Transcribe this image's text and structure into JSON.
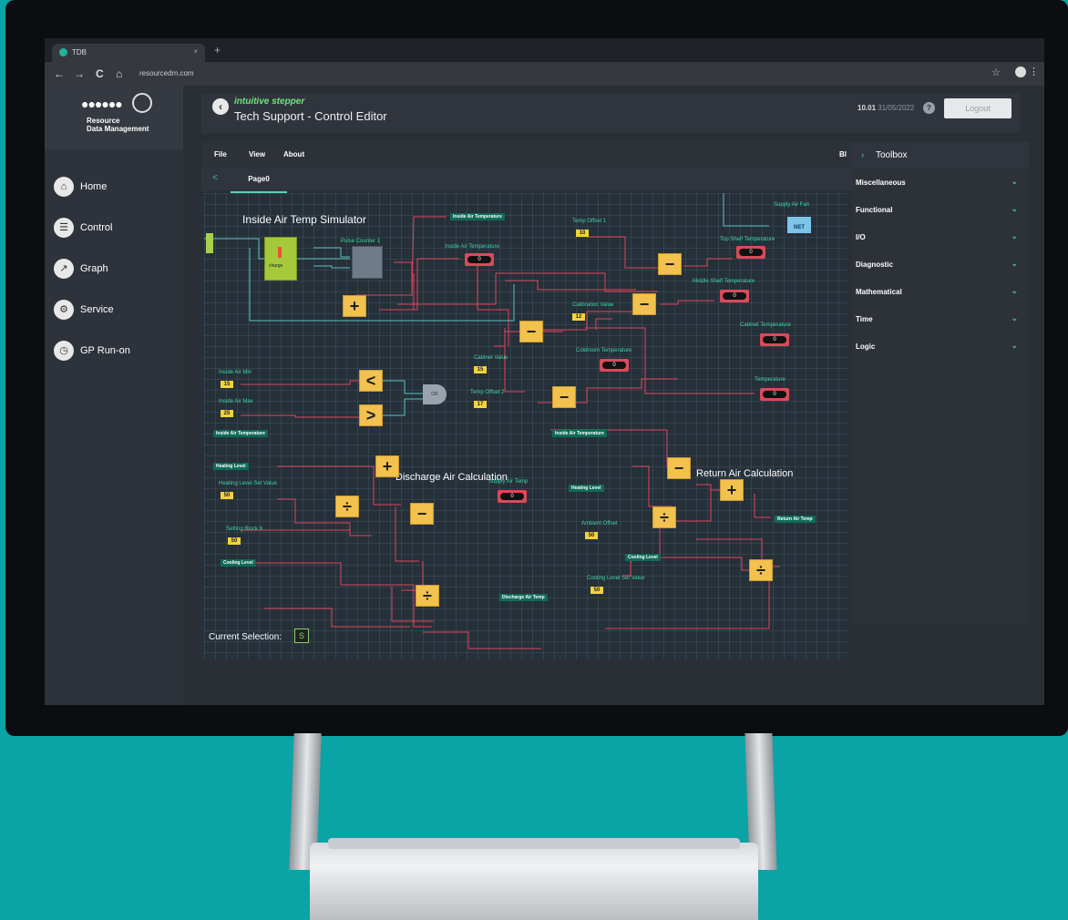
{
  "browser": {
    "tab_title": "TDB",
    "tab_close": "×",
    "new_tab": "+",
    "url": "resourcedm.com",
    "nav": [
      "←",
      "→",
      "C",
      "⌂"
    ]
  },
  "logo": {
    "text": "Resource\nData Management"
  },
  "sidebar": {
    "items": [
      {
        "label": "Home",
        "icon": "home-icon"
      },
      {
        "label": "Control",
        "icon": "list-icon"
      },
      {
        "label": "Graph",
        "icon": "graph-icon"
      },
      {
        "label": "Service",
        "icon": "gear-icon"
      },
      {
        "label": "GP Run-on",
        "icon": "clock-icon"
      }
    ]
  },
  "header": {
    "brand": "intuitive stepper",
    "title": "Tech Support - Control Editor",
    "version": "10.01",
    "date": "31/05/2022",
    "help": "?",
    "logout": "Logout"
  },
  "menubar": {
    "file": "File",
    "view": "View",
    "about": "About",
    "bl": "Bl"
  },
  "pagebar": {
    "back": "<",
    "tab": "Page0"
  },
  "toolbox": {
    "title": "Toolbox",
    "items": [
      "Miscellaneous",
      "Functional",
      "I/O",
      "Diagnostic",
      "Mathematical",
      "Time",
      "Logic"
    ]
  },
  "canvas": {
    "sections": {
      "inside": "Inside Air Temp Simulator",
      "discharge": "Discharge Air Calculation",
      "return": "Return Air Calculation"
    },
    "labels": {
      "pulse": "Pulse Counter 1",
      "supply_fan": "Supply Air Fan",
      "temp_offset1": "Temp Offset 1",
      "top_shelf": "Top Shelf Temperature",
      "middle_shelf": "Middle Shelf Temperature",
      "calibration": "Calibration Value",
      "cabinet_temp": "Cabinet Temperature",
      "inside_air_temp": "Inside Air Temperature",
      "cabinet_value": "Cabinet Value",
      "coldroom": "Coldroom Temperature",
      "temperature": "Temperature",
      "inside_min": "Inside Air Min",
      "inside_max": "Inside Air Max",
      "temp_offset2": "Temp Offset 2",
      "heating_set": "Heating Level Set Value",
      "supply_air_temp": "Supply Air Temp",
      "setting_block": "Setting Block 6",
      "ambient": "Ambient Offset",
      "cooling_set": "Cooling Level Set Value"
    },
    "tags": {
      "inside_air_temp_top": "Inside Air Temperature",
      "inside_air_temp_left": "Inside Air Temperature",
      "heating_level": "Heating Level",
      "cooling_level": "Cooling Level",
      "discharge_air_temp": "Discharge Air Temp",
      "inside_air_temp_right": "Inside Air Temperature",
      "heating_level_right": "Heating Level",
      "return_air_temp": "Return Air Temp",
      "cooling_level_right": "Cooling Level"
    },
    "values": {
      "offset1": "10",
      "calib": "12",
      "cab": "15",
      "min": "15",
      "max": "25",
      "offset2": "17",
      "heat": "50",
      "setblk": "50",
      "amb": "50",
      "cool": "50"
    },
    "displays": "0",
    "net": "NET",
    "charge": "charge"
  },
  "selection": {
    "label": "Current Selection:",
    "value": "S"
  }
}
